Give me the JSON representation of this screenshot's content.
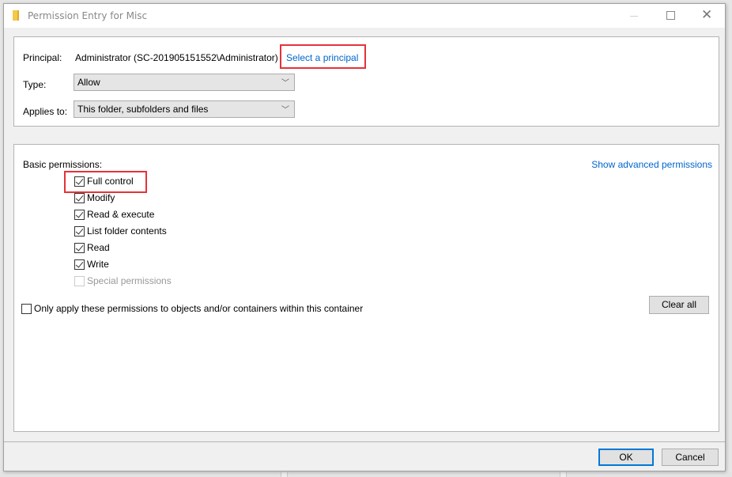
{
  "window": {
    "title": "Permission Entry for Misc",
    "icon": "folder-icon",
    "controls": {
      "minimize": "minimize-icon",
      "maximize": "maximize-icon",
      "close": "close-icon",
      "close_glyph": "✕"
    }
  },
  "principal": {
    "label": "Principal:",
    "value": "Administrator (SC-201905151552\\Administrator)",
    "select_link": "Select a principal"
  },
  "type": {
    "label": "Type:",
    "value": "Allow"
  },
  "applies_to": {
    "label": "Applies to:",
    "value": "This folder, subfolders and files"
  },
  "dropdown_glyph": "﹀",
  "basic_permissions": {
    "label": "Basic permissions:",
    "advanced_link": "Show advanced permissions",
    "items": [
      {
        "label": "Full control",
        "checked": true,
        "disabled": false
      },
      {
        "label": "Modify",
        "checked": true,
        "disabled": false
      },
      {
        "label": "Read & execute",
        "checked": true,
        "disabled": false
      },
      {
        "label": "List folder contents",
        "checked": true,
        "disabled": false
      },
      {
        "label": "Read",
        "checked": true,
        "disabled": false
      },
      {
        "label": "Write",
        "checked": true,
        "disabled": false
      },
      {
        "label": "Special permissions",
        "checked": false,
        "disabled": true
      }
    ],
    "only_apply": {
      "label": "Only apply these permissions to objects and/or containers within this container",
      "checked": false
    },
    "clear_all": "Clear all"
  },
  "footer": {
    "ok": "OK",
    "cancel": "Cancel"
  },
  "colors": {
    "link": "#0066cc",
    "highlight_box": "#e5323a",
    "default_button_border": "#0078d7"
  }
}
